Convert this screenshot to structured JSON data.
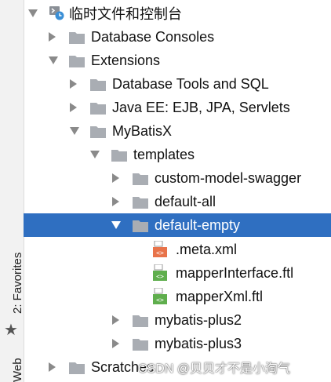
{
  "sidebar": {
    "tab_web": "Web",
    "tab_favorites": "2: Favorites",
    "star_icon": "★"
  },
  "tree": {
    "root": "临时文件和控制台",
    "database_consoles": "Database Consoles",
    "extensions": "Extensions",
    "database_tools": "Database Tools and SQL",
    "java_ee": "Java EE: EJB, JPA, Servlets",
    "mybatisx": "MyBatisX",
    "templates": "templates",
    "custom_model_swagger": "custom-model-swagger",
    "default_all": "default-all",
    "default_empty": "default-empty",
    "meta_xml": ".meta.xml",
    "mapper_interface": "mapperInterface.ftl",
    "mapper_xml": "mapperXml.ftl",
    "mybatis_plus2": "mybatis-plus2",
    "mybatis_plus3": "mybatis-plus3",
    "scratches": "Scratches"
  },
  "watermark": "CSDN @贝贝才不是小淘气",
  "colors": {
    "selection": "#2f6fc1",
    "folder": "#a9adb3",
    "xml_icon": "#e8734a",
    "ftl_icon": "#5fae4d"
  }
}
